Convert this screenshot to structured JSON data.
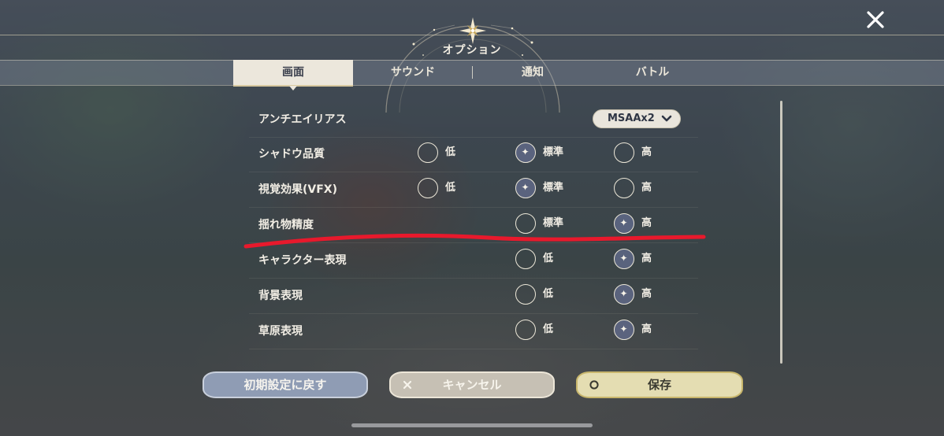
{
  "header": {
    "title": "オプション",
    "close_icon": "close-icon"
  },
  "tabs": [
    {
      "label": "画面",
      "active": true
    },
    {
      "label": "サウンド",
      "active": false
    },
    {
      "label": "通知",
      "active": false
    },
    {
      "label": "バトル",
      "active": false
    }
  ],
  "settings": {
    "antialias": {
      "label": "アンチエイリアス",
      "value": "MSAAx2"
    },
    "shadow": {
      "label": "シャドウ品質",
      "options": [
        "低",
        "標準",
        "高"
      ],
      "selected": "標準"
    },
    "vfx": {
      "label": "視覚効果(VFX)",
      "options": [
        "低",
        "標準",
        "高"
      ],
      "selected": "標準"
    },
    "sway": {
      "label": "揺れ物精度",
      "options": [
        "標準",
        "高"
      ],
      "selected": "高"
    },
    "character": {
      "label": "キャラクター表現",
      "options": [
        "低",
        "高"
      ],
      "selected": "高"
    },
    "background": {
      "label": "背景表現",
      "options": [
        "低",
        "高"
      ],
      "selected": "高"
    },
    "grass": {
      "label": "草原表現",
      "options": [
        "低",
        "高"
      ],
      "selected": "高"
    }
  },
  "buttons": {
    "reset": "初期設定に戻す",
    "cancel": "キャンセル",
    "save": "保存"
  },
  "colors": {
    "annotation_stroke": "#e8192c",
    "accent_gold": "#d8c9a0"
  }
}
